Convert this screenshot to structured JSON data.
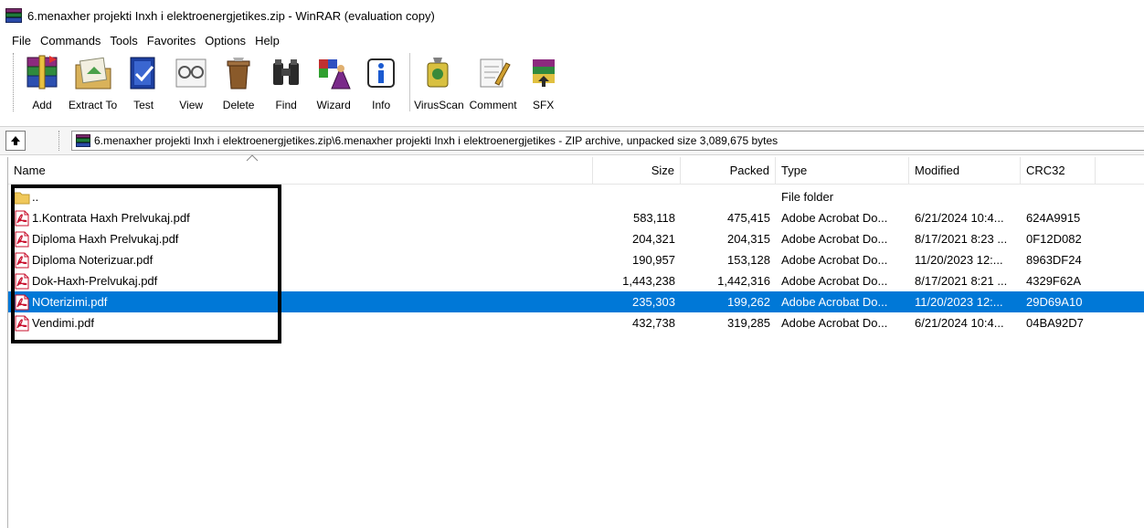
{
  "window": {
    "title": "6.menaxher projekti Inxh i elektroenergjetikes.zip - WinRAR (evaluation copy)"
  },
  "menu": [
    "File",
    "Commands",
    "Tools",
    "Favorites",
    "Options",
    "Help"
  ],
  "toolbar": {
    "add": "Add",
    "extract_to": "Extract To",
    "test": "Test",
    "view": "View",
    "delete": "Delete",
    "find": "Find",
    "wizard": "Wizard",
    "info": "Info",
    "virusscan": "VirusScan",
    "comment": "Comment",
    "sfx": "SFX"
  },
  "address": {
    "path": "6.menaxher projekti Inxh i elektroenergjetikes.zip\\6.menaxher projekti Inxh i elektroenergjetikes - ZIP archive, unpacked size 3,089,675 bytes"
  },
  "columns": {
    "name": "Name",
    "size": "Size",
    "packed": "Packed",
    "type": "Type",
    "modified": "Modified",
    "crc32": "CRC32"
  },
  "files": [
    {
      "name": "..",
      "size": "",
      "packed": "",
      "type": "File folder",
      "modified": "",
      "crc": "",
      "icon": "folder-icon"
    },
    {
      "name": "1.Kontrata Haxh Prelvukaj.pdf",
      "size": "583,118",
      "packed": "475,415",
      "type": "Adobe Acrobat Do...",
      "modified": "6/21/2024 10:4...",
      "crc": "624A9915",
      "icon": "pdf-icon"
    },
    {
      "name": "Diploma Haxh Prelvukaj.pdf",
      "size": "204,321",
      "packed": "204,315",
      "type": "Adobe Acrobat Do...",
      "modified": "8/17/2021 8:23 ...",
      "crc": "0F12D082",
      "icon": "pdf-icon"
    },
    {
      "name": "Diploma Noterizuar.pdf",
      "size": "190,957",
      "packed": "153,128",
      "type": "Adobe Acrobat Do...",
      "modified": "11/20/2023 12:...",
      "crc": "8963DF24",
      "icon": "pdf-icon"
    },
    {
      "name": "Dok-Haxh-Prelvukaj.pdf",
      "size": "1,443,238",
      "packed": "1,442,316",
      "type": "Adobe Acrobat Do...",
      "modified": "8/17/2021 8:21 ...",
      "crc": "4329F62A",
      "icon": "pdf-icon"
    },
    {
      "name": "NOterizimi.pdf",
      "size": "235,303",
      "packed": "199,262",
      "type": "Adobe Acrobat Do...",
      "modified": "11/20/2023 12:...",
      "crc": "29D69A10",
      "icon": "pdf-icon",
      "selected": true
    },
    {
      "name": "Vendimi.pdf",
      "size": "432,738",
      "packed": "319,285",
      "type": "Adobe Acrobat Do...",
      "modified": "6/21/2024 10:4...",
      "crc": "04BA92D7",
      "icon": "pdf-icon"
    }
  ],
  "colors": {
    "selection": "#0078d7",
    "pdf_red": "#c8102e",
    "folder_yellow": "#f0c85a",
    "annotation_box": "#000000"
  }
}
